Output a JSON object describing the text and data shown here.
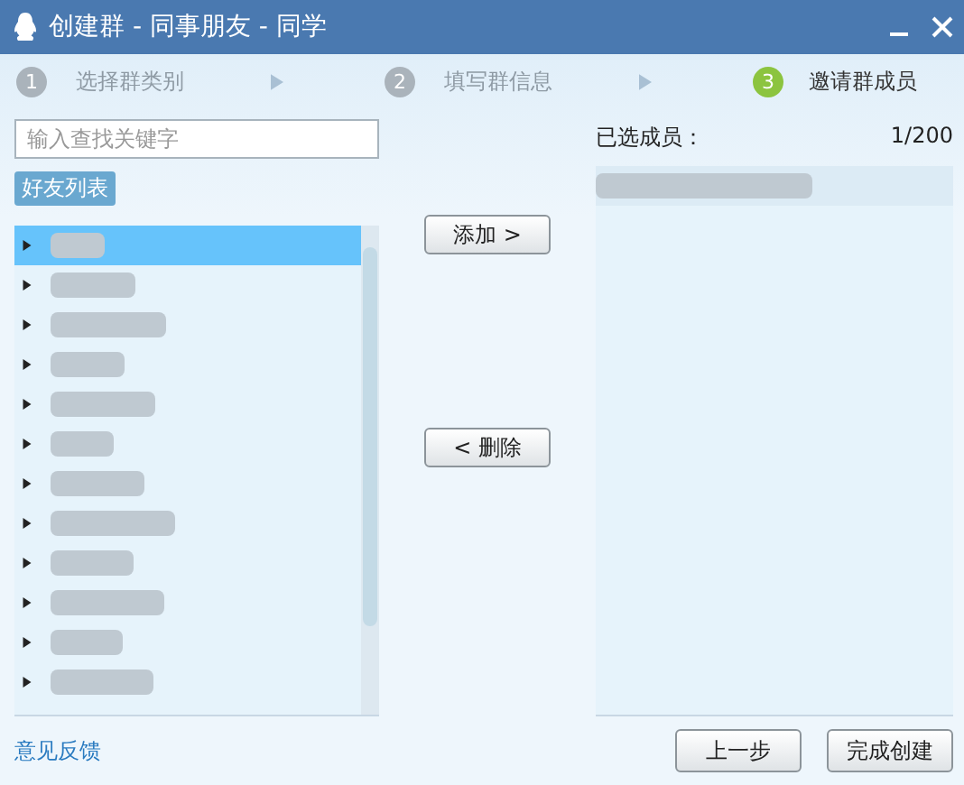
{
  "window": {
    "title": "创建群 - 同事朋友 - 同学"
  },
  "steps": [
    {
      "number": "1",
      "label": "选择群类别",
      "selected": false
    },
    {
      "number": "2",
      "label": "填写群信息",
      "selected": false
    },
    {
      "number": "3",
      "label": "邀请群成员",
      "selected": true
    }
  ],
  "search": {
    "placeholder": "输入查找关键字"
  },
  "friend_tab": {
    "label": "好友列表"
  },
  "groups": [
    {
      "selected": true,
      "expanded": false
    },
    {
      "selected": false,
      "expanded": false
    },
    {
      "selected": false,
      "expanded": false
    },
    {
      "selected": false,
      "expanded": false
    },
    {
      "selected": false,
      "expanded": false
    },
    {
      "selected": false,
      "expanded": false
    },
    {
      "selected": false,
      "expanded": false
    },
    {
      "selected": false,
      "expanded": false
    },
    {
      "selected": false,
      "expanded": false
    },
    {
      "selected": false,
      "expanded": false
    },
    {
      "selected": false,
      "expanded": false
    },
    {
      "selected": false,
      "expanded": false
    }
  ],
  "add_button": "添加 >",
  "remove_button": "< 删除",
  "selected_members": {
    "label": "已选成员：",
    "count": "1/200",
    "members": [
      {
        "selected": false
      }
    ]
  },
  "feedback_link": "意见反馈",
  "buttons": [
    "上一步",
    "完成创建"
  ]
}
